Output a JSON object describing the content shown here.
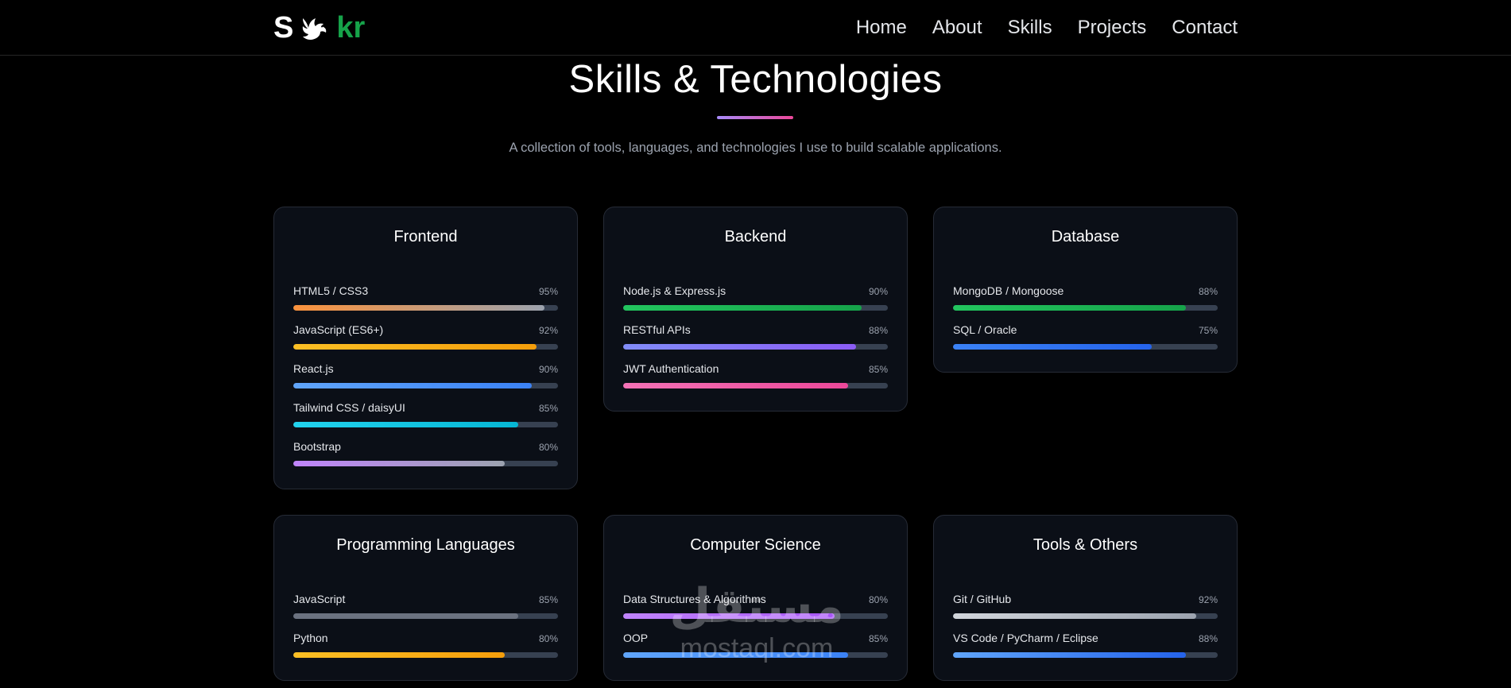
{
  "header": {
    "logo_left": "S",
    "logo_right": "kr",
    "nav": [
      {
        "label": "Home"
      },
      {
        "label": "About"
      },
      {
        "label": "Skills"
      },
      {
        "label": "Projects"
      },
      {
        "label": "Contact"
      }
    ]
  },
  "section": {
    "title": "Skills & Technologies",
    "subtitle": "A collection of tools, languages, and technologies I use to build scalable applications."
  },
  "cards": [
    {
      "title": "Frontend",
      "skills": [
        {
          "name": "HTML5 / CSS3",
          "pct_label": "95%",
          "value": 95,
          "gradient": [
            "#fb923c",
            "#9ca3af"
          ]
        },
        {
          "name": "JavaScript (ES6+)",
          "pct_label": "92%",
          "value": 92,
          "gradient": [
            "#fbbf24",
            "#f59e0b"
          ]
        },
        {
          "name": "React.js",
          "pct_label": "90%",
          "value": 90,
          "gradient": [
            "#60a5fa",
            "#3b82f6"
          ]
        },
        {
          "name": "Tailwind CSS / daisyUI",
          "pct_label": "85%",
          "value": 85,
          "gradient": [
            "#22d3ee",
            "#06b6d4"
          ]
        },
        {
          "name": "Bootstrap",
          "pct_label": "80%",
          "value": 80,
          "gradient": [
            "#c084fc",
            "#9ca3af"
          ]
        }
      ]
    },
    {
      "title": "Backend",
      "skills": [
        {
          "name": "Node.js & Express.js",
          "pct_label": "90%",
          "value": 90,
          "gradient": [
            "#22c55e",
            "#16a34a"
          ]
        },
        {
          "name": "RESTful APIs",
          "pct_label": "88%",
          "value": 88,
          "gradient": [
            "#818cf8",
            "#8b5cf6"
          ]
        },
        {
          "name": "JWT Authentication",
          "pct_label": "85%",
          "value": 85,
          "gradient": [
            "#f472b6",
            "#ec4899"
          ]
        }
      ]
    },
    {
      "title": "Database",
      "skills": [
        {
          "name": "MongoDB / Mongoose",
          "pct_label": "88%",
          "value": 88,
          "gradient": [
            "#22c55e",
            "#16a34a"
          ]
        },
        {
          "name": "SQL / Oracle",
          "pct_label": "75%",
          "value": 75,
          "gradient": [
            "#3b82f6",
            "#2563eb"
          ]
        }
      ]
    },
    {
      "title": "Programming Languages",
      "skills": [
        {
          "name": "JavaScript",
          "pct_label": "85%",
          "value": 85,
          "gradient": [
            "#6b7280",
            "#6b7280"
          ]
        },
        {
          "name": "Python",
          "pct_label": "80%",
          "value": 80,
          "gradient": [
            "#fbbf24",
            "#f59e0b"
          ]
        }
      ]
    },
    {
      "title": "Computer Science",
      "skills": [
        {
          "name": "Data Structures & Algorithms",
          "pct_label": "80%",
          "value": 80,
          "gradient": [
            "#c084fc",
            "#a855f7"
          ]
        },
        {
          "name": "OOP",
          "pct_label": "85%",
          "value": 85,
          "gradient": [
            "#60a5fa",
            "#3b82f6"
          ]
        }
      ]
    },
    {
      "title": "Tools & Others",
      "skills": [
        {
          "name": "Git / GitHub",
          "pct_label": "92%",
          "value": 92,
          "gradient": [
            "#d1d5db",
            "#9ca3af"
          ]
        },
        {
          "name": "VS Code / PyCharm / Eclipse",
          "pct_label": "88%",
          "value": 88,
          "gradient": [
            "#60a5fa",
            "#2563eb"
          ]
        }
      ]
    }
  ],
  "watermark": {
    "arabic": "مستقل",
    "latin": "mostaql.com"
  }
}
